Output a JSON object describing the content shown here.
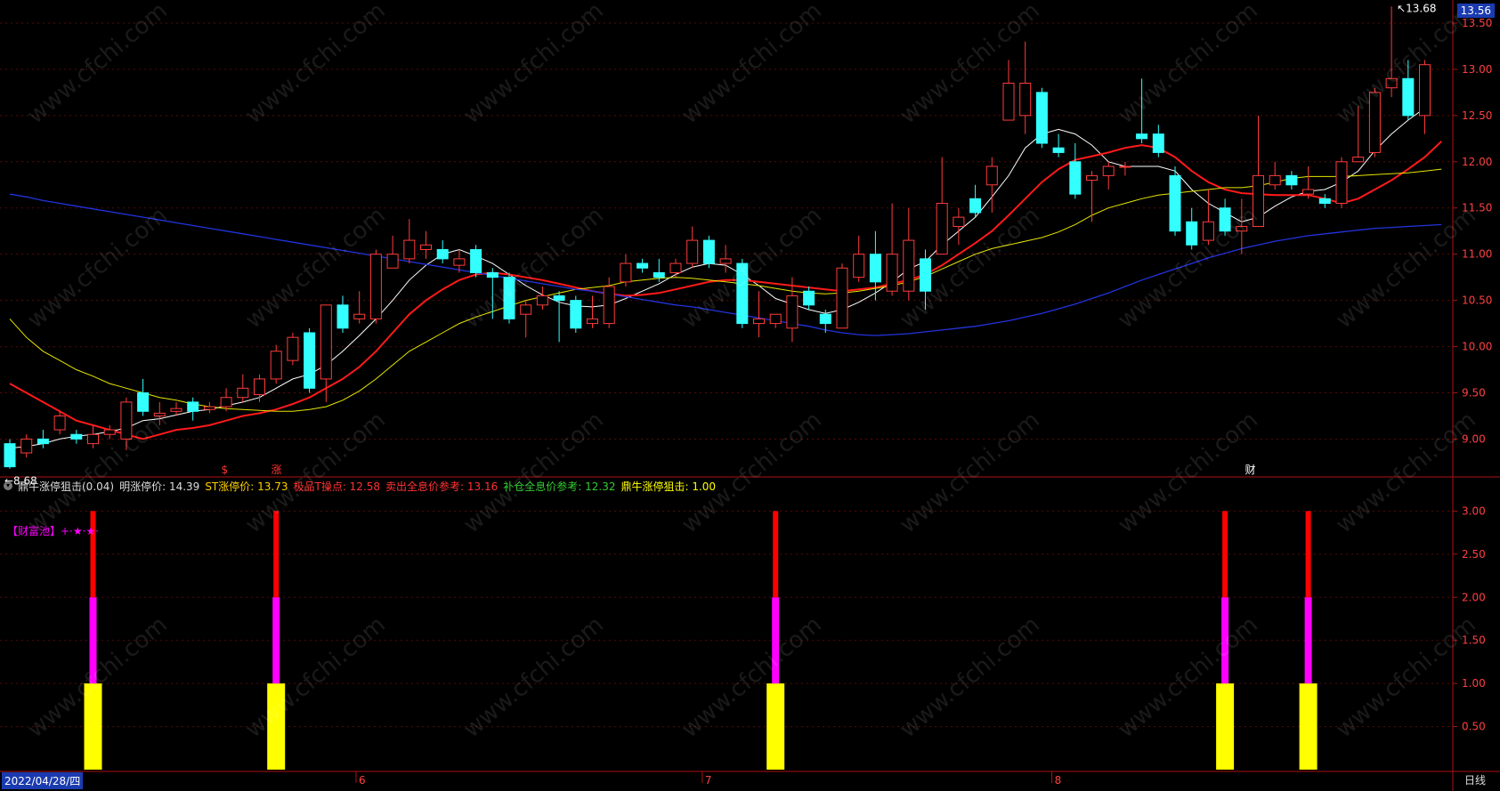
{
  "window": {
    "title_fragment": "",
    "top_right_icon": "app-window-icon"
  },
  "main_panel": {
    "current_price_tag": "13.56",
    "max_annotation": "13.68",
    "min_annotation": "8.68",
    "y_axis_ticks": [
      "13.50",
      "13.00",
      "12.50",
      "12.00",
      "11.50",
      "11.00",
      "10.50",
      "10.00",
      "9.50",
      "9.00"
    ],
    "markers": [
      {
        "text": "$",
        "color": "#ff3333"
      },
      {
        "text": "涨",
        "color": "#ff3333"
      },
      {
        "text": "财",
        "color": "#ffffff"
      }
    ],
    "watermark": "www.cfchi.com"
  },
  "indicator": {
    "name": "鼎牛涨停狙击(0.04)",
    "fields": [
      {
        "label": "明涨停价: 14.39",
        "color": "#dddddd"
      },
      {
        "label": "ST涨停价: 13.73",
        "color": "#ffd000"
      },
      {
        "label": "极品T操点: 12.58",
        "color": "#ff3333"
      },
      {
        "label": "卖出全息价参考: 13.16",
        "color": "#ff3333"
      },
      {
        "label": "补仓全息价参考: 12.32",
        "color": "#33cc33"
      },
      {
        "label": "鼎牛涨停狙击: 1.00",
        "color": "#ffff00"
      }
    ],
    "pool_label": "【财富池】+·★·★·",
    "y_axis_ticks": [
      "3.00",
      "2.50",
      "2.00",
      "1.50",
      "1.00",
      "0.50"
    ]
  },
  "x_axis": {
    "date_label": "2022/04/28/四",
    "month_labels": [
      "6",
      "7",
      "8"
    ],
    "period_tab": "日线"
  },
  "colors": {
    "up": "#ff3b3b",
    "down": "#33ffff",
    "ma5": "#ffffff",
    "ma10": "#ff1a1a",
    "ma20": "#e6e600",
    "ma60": "#2233dd"
  },
  "chart_data": {
    "type": "candlestick",
    "ylim": [
      8.6,
      13.75
    ],
    "candles": [
      [
        8.95,
        8.7,
        9.0,
        8.68
      ],
      [
        8.85,
        9.0,
        9.05,
        8.8
      ],
      [
        9.0,
        8.95,
        9.1,
        8.9
      ],
      [
        9.1,
        9.25,
        9.3,
        9.05
      ],
      [
        9.05,
        9.0,
        9.1,
        8.95
      ],
      [
        8.95,
        9.05,
        9.15,
        8.9
      ],
      [
        9.05,
        9.1,
        9.15,
        9.0
      ],
      [
        9.0,
        9.4,
        9.45,
        8.88
      ],
      [
        9.5,
        9.3,
        9.65,
        9.25
      ],
      [
        9.25,
        9.28,
        9.4,
        9.15
      ],
      [
        9.3,
        9.33,
        9.4,
        9.25
      ],
      [
        9.4,
        9.3,
        9.45,
        9.2
      ],
      [
        9.32,
        9.35,
        9.4,
        9.28
      ],
      [
        9.35,
        9.45,
        9.55,
        9.3
      ],
      [
        9.45,
        9.55,
        9.7,
        9.4
      ],
      [
        9.48,
        9.65,
        9.7,
        9.4
      ],
      [
        9.65,
        9.95,
        10.02,
        9.6
      ],
      [
        9.85,
        10.1,
        10.15,
        9.8
      ],
      [
        10.15,
        9.55,
        10.2,
        9.5
      ],
      [
        9.65,
        10.45,
        10.45,
        9.4
      ],
      [
        10.45,
        10.2,
        10.55,
        10.15
      ],
      [
        10.3,
        10.35,
        10.6,
        10.25
      ],
      [
        10.3,
        11.0,
        11.05,
        10.25
      ],
      [
        10.85,
        11.0,
        11.2,
        10.85
      ],
      [
        10.95,
        11.15,
        11.38,
        10.9
      ],
      [
        11.05,
        11.1,
        11.25,
        10.95
      ],
      [
        11.05,
        10.95,
        11.15,
        10.9
      ],
      [
        10.88,
        10.95,
        11.05,
        10.8
      ],
      [
        11.05,
        10.8,
        11.1,
        10.75
      ],
      [
        10.8,
        10.75,
        10.85,
        10.3
      ],
      [
        10.75,
        10.3,
        10.8,
        10.25
      ],
      [
        10.35,
        10.45,
        10.5,
        10.1
      ],
      [
        10.45,
        10.55,
        10.65,
        10.4
      ],
      [
        10.55,
        10.5,
        10.6,
        10.05
      ],
      [
        10.5,
        10.2,
        10.55,
        10.15
      ],
      [
        10.25,
        10.3,
        10.55,
        10.2
      ],
      [
        10.25,
        10.65,
        10.75,
        10.2
      ],
      [
        10.7,
        10.9,
        11.0,
        10.65
      ],
      [
        10.9,
        10.85,
        10.95,
        10.8
      ],
      [
        10.8,
        10.75,
        10.95,
        10.7
      ],
      [
        10.8,
        10.9,
        10.95,
        10.75
      ],
      [
        10.9,
        11.15,
        11.3,
        10.85
      ],
      [
        11.15,
        10.9,
        11.2,
        10.85
      ],
      [
        10.9,
        10.95,
        11.1,
        10.8
      ],
      [
        10.9,
        10.25,
        10.95,
        10.2
      ],
      [
        10.25,
        10.3,
        10.6,
        10.1
      ],
      [
        10.25,
        10.35,
        10.35,
        10.2
      ],
      [
        10.2,
        10.55,
        10.75,
        10.05
      ],
      [
        10.6,
        10.45,
        10.65,
        10.4
      ],
      [
        10.35,
        10.25,
        10.4,
        10.15
      ],
      [
        10.2,
        10.85,
        10.9,
        10.2
      ],
      [
        10.75,
        11.0,
        11.2,
        10.7
      ],
      [
        11.0,
        10.7,
        11.25,
        10.5
      ],
      [
        10.6,
        11.0,
        11.55,
        10.55
      ],
      [
        10.6,
        11.15,
        11.5,
        10.5
      ],
      [
        10.95,
        10.6,
        11.05,
        10.4
      ],
      [
        11.0,
        11.55,
        12.05,
        11.0
      ],
      [
        11.3,
        11.4,
        11.5,
        11.1
      ],
      [
        11.6,
        11.45,
        11.75,
        11.4
      ],
      [
        11.75,
        11.95,
        12.05,
        11.45
      ],
      [
        12.45,
        12.85,
        13.1,
        12.5
      ],
      [
        12.5,
        12.85,
        13.3,
        12.3
      ],
      [
        12.75,
        12.2,
        12.8,
        12.15
      ],
      [
        12.15,
        12.1,
        12.3,
        12.05
      ],
      [
        12.0,
        11.65,
        12.2,
        11.6
      ],
      [
        11.8,
        11.85,
        11.9,
        11.35
      ],
      [
        11.85,
        11.95,
        12.0,
        11.7
      ],
      [
        11.95,
        11.95,
        12.0,
        11.85
      ],
      [
        12.3,
        12.25,
        12.9,
        12.2
      ],
      [
        12.3,
        12.1,
        12.4,
        12.05
      ],
      [
        11.85,
        11.25,
        11.95,
        11.2
      ],
      [
        11.35,
        11.1,
        11.5,
        11.05
      ],
      [
        11.15,
        11.35,
        11.7,
        11.1
      ],
      [
        11.5,
        11.25,
        11.6,
        11.2
      ],
      [
        11.25,
        11.3,
        11.6,
        11.0
      ],
      [
        11.3,
        11.85,
        12.5,
        11.3
      ],
      [
        11.75,
        11.85,
        12.0,
        11.7
      ],
      [
        11.85,
        11.75,
        11.9,
        11.7
      ],
      [
        11.65,
        11.7,
        11.95,
        11.6
      ],
      [
        11.6,
        11.55,
        11.65,
        11.5
      ],
      [
        11.55,
        12.0,
        12.05,
        11.5
      ],
      [
        12.0,
        12.05,
        12.6,
        12.0
      ],
      [
        12.1,
        12.75,
        12.8,
        12.05
      ],
      [
        12.8,
        12.9,
        13.68,
        12.7
      ],
      [
        12.9,
        12.5,
        13.1,
        12.45
      ],
      [
        12.5,
        13.05,
        13.1,
        12.3
      ]
    ],
    "series": [
      {
        "values": [
          8.9,
          8.92,
          8.95,
          9.0,
          9.03,
          9.05,
          9.08,
          9.12,
          9.2,
          9.22,
          9.26,
          9.3,
          9.32,
          9.36,
          9.4,
          9.45,
          9.55,
          9.65,
          9.7,
          9.8,
          9.95,
          10.12,
          10.3,
          10.5,
          10.72,
          10.88,
          11.0,
          11.05,
          10.98,
          10.9,
          10.78,
          10.66,
          10.56,
          10.48,
          10.44,
          10.43,
          10.45,
          10.52,
          10.6,
          10.68,
          10.78,
          10.86,
          10.9,
          10.88,
          10.78,
          10.66,
          10.52,
          10.46,
          10.4,
          10.36,
          10.4,
          10.48,
          10.58,
          10.7,
          10.84,
          10.92,
          11.1,
          11.25,
          11.4,
          11.62,
          11.85,
          12.15,
          12.3,
          12.35,
          12.3,
          12.18,
          12.0,
          11.95,
          11.95,
          11.95,
          11.9,
          11.7,
          11.55,
          11.45,
          11.35,
          11.4,
          11.52,
          11.62,
          11.68,
          11.7,
          11.78,
          11.9,
          12.12,
          12.3,
          12.45,
          12.58
        ]
      },
      {
        "values": [
          9.6,
          9.5,
          9.4,
          9.3,
          9.2,
          9.15,
          9.1,
          9.05,
          9.0,
          9.05,
          9.1,
          9.12,
          9.15,
          9.2,
          9.25,
          9.28,
          9.32,
          9.38,
          9.45,
          9.55,
          9.65,
          9.78,
          9.95,
          10.15,
          10.35,
          10.5,
          10.62,
          10.72,
          10.78,
          10.8,
          10.78,
          10.75,
          10.72,
          10.68,
          10.64,
          10.6,
          10.57,
          10.55,
          10.56,
          10.58,
          10.62,
          10.66,
          10.7,
          10.72,
          10.72,
          10.7,
          10.68,
          10.66,
          10.64,
          10.62,
          10.6,
          10.62,
          10.64,
          10.68,
          10.72,
          10.78,
          10.88,
          11.0,
          11.12,
          11.25,
          11.42,
          11.6,
          11.78,
          11.92,
          12.02,
          12.06,
          12.1,
          12.15,
          12.18,
          12.15,
          12.05,
          11.9,
          11.78,
          11.7,
          11.66,
          11.65,
          11.64,
          11.64,
          11.64,
          11.6,
          11.55,
          11.6,
          11.7,
          11.8,
          11.92,
          12.05,
          12.22
        ]
      },
      {
        "values": [
          10.3,
          10.1,
          9.95,
          9.85,
          9.75,
          9.68,
          9.6,
          9.55,
          9.5,
          9.45,
          9.42,
          9.38,
          9.35,
          9.33,
          9.32,
          9.31,
          9.3,
          9.3,
          9.32,
          9.35,
          9.42,
          9.52,
          9.65,
          9.8,
          9.95,
          10.05,
          10.15,
          10.25,
          10.32,
          10.38,
          10.44,
          10.5,
          10.54,
          10.58,
          10.62,
          10.64,
          10.66,
          10.7,
          10.72,
          10.74,
          10.75,
          10.74,
          10.72,
          10.7,
          10.68,
          10.66,
          10.63,
          10.6,
          10.58,
          10.57,
          10.58,
          10.6,
          10.63,
          10.66,
          10.7,
          10.76,
          10.84,
          10.92,
          11.0,
          11.06,
          11.1,
          11.14,
          11.18,
          11.24,
          11.32,
          11.42,
          11.5,
          11.55,
          11.6,
          11.64,
          11.66,
          11.68,
          11.7,
          11.72,
          11.72,
          11.74,
          11.78,
          11.82,
          11.84,
          11.84,
          11.84,
          11.85,
          11.86,
          11.87,
          11.88,
          11.9,
          11.92
        ]
      },
      {
        "values": [
          11.65,
          11.62,
          11.58,
          11.55,
          11.52,
          11.49,
          11.46,
          11.43,
          11.4,
          11.37,
          11.34,
          11.31,
          11.28,
          11.25,
          11.22,
          11.19,
          11.16,
          11.13,
          11.1,
          11.07,
          11.04,
          11.01,
          10.98,
          10.95,
          10.92,
          10.89,
          10.86,
          10.83,
          10.8,
          10.77,
          10.74,
          10.71,
          10.68,
          10.65,
          10.62,
          10.6,
          10.57,
          10.54,
          10.51,
          10.48,
          10.45,
          10.43,
          10.4,
          10.37,
          10.34,
          10.31,
          10.28,
          10.25,
          10.22,
          10.18,
          10.15,
          10.13,
          10.12,
          10.13,
          10.14,
          10.16,
          10.18,
          10.2,
          10.22,
          10.25,
          10.28,
          10.32,
          10.36,
          10.41,
          10.46,
          10.52,
          10.58,
          10.65,
          10.72,
          10.78,
          10.84,
          10.9,
          10.96,
          11.01,
          11.06,
          11.1,
          11.14,
          11.17,
          11.2,
          11.22,
          11.24,
          11.26,
          11.28,
          11.29,
          11.3,
          11.31,
          11.32
        ]
      }
    ],
    "signals": [
      {
        "x_index": 5,
        "value": 3.0
      },
      {
        "x_index": 16,
        "value": 3.0
      },
      {
        "x_index": 46,
        "value": 3.0
      },
      {
        "x_index": 73,
        "value": 3.0
      },
      {
        "x_index": 78,
        "value": 3.0
      }
    ],
    "signal_ylim": [
      0,
      3.2
    ]
  }
}
